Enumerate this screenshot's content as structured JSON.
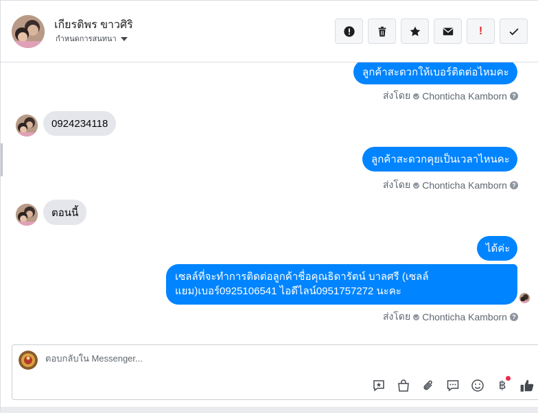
{
  "header": {
    "contact_name": "เกียรติพร ขาวศิริ",
    "assign_label": "กำหนดการสนทนา",
    "actions": [
      {
        "name": "spam-button",
        "icon": "alert-circle-icon"
      },
      {
        "name": "delete-button",
        "icon": "trash-icon"
      },
      {
        "name": "star-button",
        "icon": "star-icon"
      },
      {
        "name": "mark-unread-button",
        "icon": "envelope-icon"
      },
      {
        "name": "follow-up-button",
        "icon": "exclamation-icon",
        "text": "!"
      },
      {
        "name": "mark-done-button",
        "icon": "check-icon"
      }
    ]
  },
  "messages": [
    {
      "direction": "out",
      "text": "ลูกค้าสะดวกให้เบอร์ติดต่อไหมคะ"
    },
    {
      "sent_by_prefix": "ส่งโดย",
      "sent_by_name": "Chonticha Kamborn"
    },
    {
      "direction": "in",
      "text": "0924234118"
    },
    {
      "direction": "out",
      "text": "ลูกค้าสะดวกคุยเป็นเวลาไหนคะ"
    },
    {
      "sent_by_prefix": "ส่งโดย",
      "sent_by_name": "Chonticha Kamborn"
    },
    {
      "direction": "in",
      "text": "ตอนนี้"
    },
    {
      "direction": "out",
      "text": "ได้ค่ะ"
    },
    {
      "direction": "out",
      "text": "เซลล์ที่จะทำการติดต่อลูกค้าชื่อคุณธิดารัตน์ บาลศรี (เซลล์แยม)เบอร์0925106541 ไอดีไลน์0951757272 นะคะ"
    },
    {
      "sent_by_prefix": "ส่งโดย",
      "sent_by_name": "Chonticha Kamborn"
    }
  ],
  "composer": {
    "placeholder": "ตอบกลับใน Messenger...",
    "tools": [
      "saved-reply-icon",
      "shop-bag-icon",
      "attachment-icon",
      "message-icon",
      "emoji-icon",
      "baht-icon",
      "like-icon"
    ],
    "baht_symbol": "฿"
  },
  "colors": {
    "outgoing_bubble": "#0084ff",
    "incoming_bubble": "#e4e6eb",
    "follow_up_red": "#e02424",
    "notification_dot": "#f02849"
  }
}
